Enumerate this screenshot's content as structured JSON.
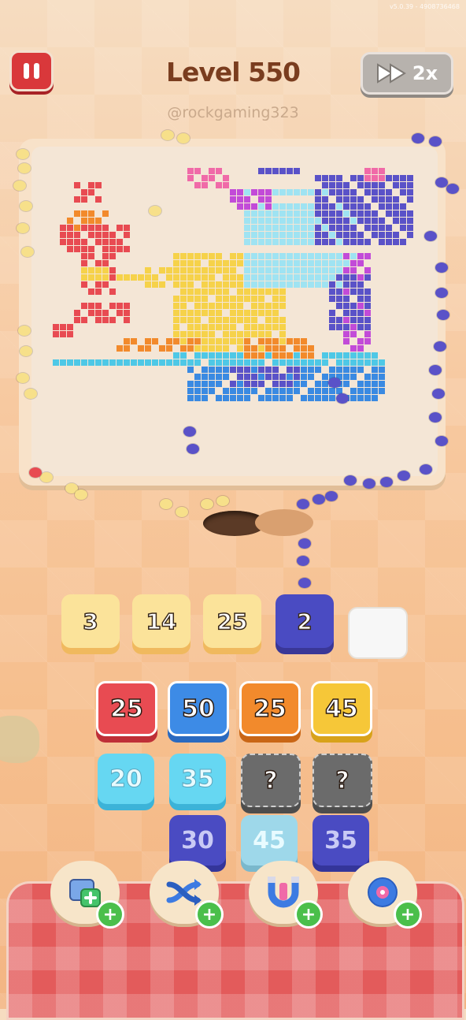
{
  "status_bar": {
    "version": "v5.0.39 - 4908736468"
  },
  "header": {
    "level_title": "Level 550",
    "speed_label": "2x",
    "watermark": "@rockgaming323"
  },
  "icons": {
    "pause": "pause-icon",
    "fast_forward": "fast-forward-icon",
    "add": "plus-icon"
  },
  "slots": [
    {
      "value": "3",
      "color": "yellow"
    },
    {
      "value": "14",
      "color": "yellow"
    },
    {
      "value": "25",
      "color": "yellow"
    },
    {
      "value": "2",
      "color": "purple"
    },
    {
      "value": "",
      "color": "empty"
    }
  ],
  "tile_columns": [
    [
      {
        "value": "25",
        "color": "#e84b52",
        "shade": "#bf2f37"
      },
      {
        "value": "20",
        "color": "#66d7f2",
        "shade": "#3cb3d8"
      }
    ],
    [
      {
        "value": "50",
        "color": "#3d8be6",
        "shade": "#2a6ac0"
      },
      {
        "value": "35",
        "color": "#66d7f2",
        "shade": "#3cb3d8"
      }
    ],
    [
      {
        "value": "25",
        "color": "#f28a2c",
        "shade": "#c96616"
      },
      {
        "value": "?",
        "color": "#6b6b6b",
        "shade": "#4d4d4d"
      },
      {
        "value": "45",
        "color": "#9ed8ea",
        "shade": "#7ab8cc"
      }
    ],
    [
      {
        "value": "45",
        "color": "#f6c738",
        "shade": "#d8a21a"
      },
      {
        "value": "?",
        "color": "#6b6b6b",
        "shade": "#4d4d4d"
      },
      {
        "value": "35",
        "color": "#4a4bc2",
        "shade": "#34359a"
      }
    ]
  ],
  "extra_tile": {
    "value": "30",
    "color": "#4a4bc2",
    "shade": "#34359a"
  },
  "powerups": [
    {
      "name": "add-slot",
      "icon": "tray-plus-icon"
    },
    {
      "name": "shuffle",
      "icon": "shuffle-arrows-icon"
    },
    {
      "name": "magnet",
      "icon": "magnet-icon"
    },
    {
      "name": "donut",
      "icon": "donut-icon"
    }
  ],
  "colors": {
    "red": "#e84b52",
    "orange": "#f28a2c",
    "yellow": "#f6d24a",
    "pink": "#f06aa8",
    "purple": "#5a52c8",
    "light_blue": "#9fe3f2",
    "cyan": "#4ec8e6",
    "blue": "#3a8ae2",
    "magenta": "#c24bd8",
    "board": "#f4e6d6"
  }
}
